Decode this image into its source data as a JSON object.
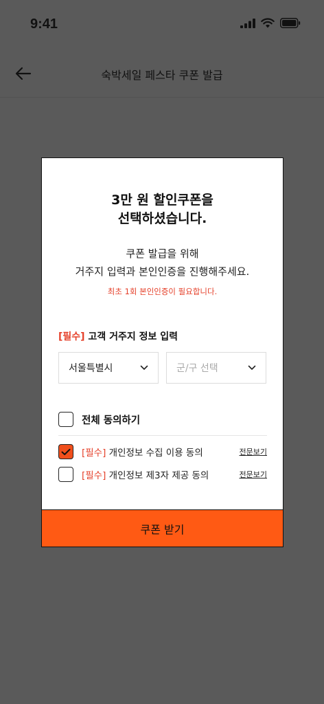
{
  "status_bar": {
    "time": "9:41"
  },
  "header": {
    "title": "숙박세일 페스타 쿠폰 발급"
  },
  "modal": {
    "title_line1": "3만 원 할인쿠폰을",
    "title_line2": "선택하셨습니다.",
    "desc_line1": "쿠폰 발급을 위해",
    "desc_line2": "거주지 입력과 본인인증을 진행해주세요.",
    "notice": "최초 1회 본인인증이 필요합니다.",
    "section": {
      "required_tag": "[필수]",
      "label": " 고객 거주지 정보 입력"
    },
    "city_select": {
      "value": "서울특별시"
    },
    "district_select": {
      "placeholder": "군/구 선택"
    },
    "agree_all": {
      "label": "전체 동의하기",
      "checked": false
    },
    "agreements": [
      {
        "required_tag": "[필수]",
        "label": " 개인정보 수집 이용 동의",
        "link": "전문보기",
        "checked": true
      },
      {
        "required_tag": "[필수]",
        "label": " 개인정보 제3자 제공 동의",
        "link": "전문보기",
        "checked": false
      }
    ],
    "cta_label": "쿠폰 받기"
  },
  "colors": {
    "overlay": "#5a5a5a",
    "accent": "#ff5a14",
    "required": "#e5402a"
  },
  "icons": [
    "back-arrow-icon",
    "signal-icon",
    "wifi-icon",
    "battery-icon",
    "chevron-down-icon",
    "check-icon"
  ]
}
